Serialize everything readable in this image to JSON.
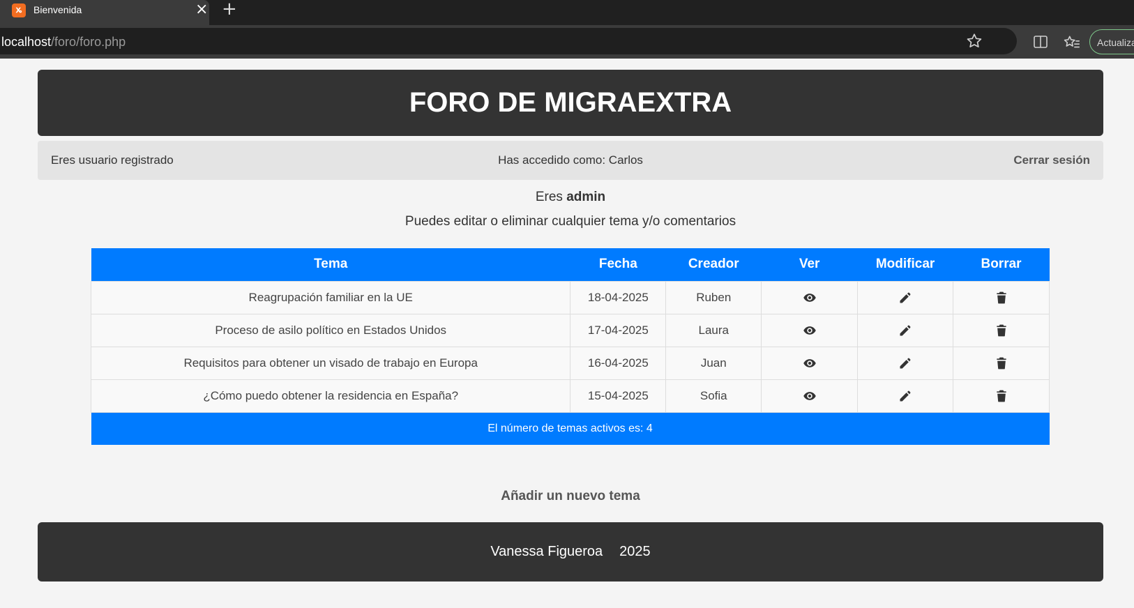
{
  "browser": {
    "tab_title": "Bienvenida",
    "url_host": "localhost",
    "url_path": "/foro/foro.php",
    "update_button": "Actualizar"
  },
  "header": {
    "title": "FORO DE MIGRAEXTRA"
  },
  "userbar": {
    "status": "Eres usuario registrado",
    "logged_as": "Has accedido como: Carlos",
    "logout": "Cerrar sesión"
  },
  "role": {
    "prefix": "Eres",
    "name": "admin"
  },
  "permissions_text": "Puedes editar o eliminar cualquier tema y/o comentarios",
  "table": {
    "headers": [
      "Tema",
      "Fecha",
      "Creador",
      "Ver",
      "Modificar",
      "Borrar"
    ],
    "rows": [
      {
        "tema": "Reagrupación familiar en la UE",
        "fecha": "18-04-2025",
        "creador": "Ruben"
      },
      {
        "tema": "Proceso de asilo político en Estados Unidos",
        "fecha": "17-04-2025",
        "creador": "Laura"
      },
      {
        "tema": "Requisitos para obtener un visado de trabajo en Europa",
        "fecha": "16-04-2025",
        "creador": "Juan"
      },
      {
        "tema": "¿Cómo puedo obtener la residencia en España?",
        "fecha": "15-04-2025",
        "creador": "Sofia"
      }
    ],
    "footer": "El número de temas activos es: 4"
  },
  "add_topic": "Añadir un nuevo tema",
  "footer": {
    "author": "Vanessa Figueroa",
    "year": "2025"
  },
  "icons": {
    "view": "eye-icon",
    "edit": "pencil-icon",
    "delete": "trash-icon"
  },
  "colors": {
    "accent": "#007bff",
    "dark": "#333333"
  }
}
